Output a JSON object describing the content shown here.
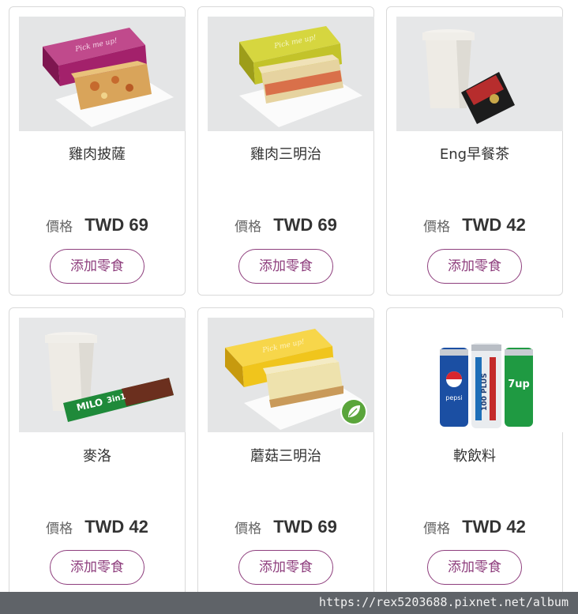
{
  "price_label": "價格",
  "button_label": "添加零食",
  "products": [
    {
      "name": "雞肉披薩",
      "price": "TWD 69"
    },
    {
      "name": "雞肉三明治",
      "price": "TWD 69"
    },
    {
      "name": "Eng早餐茶",
      "price": "TWD 42"
    },
    {
      "name": "麥洛",
      "price": "TWD 42"
    },
    {
      "name": "蘑菇三明治",
      "price": "TWD 69"
    },
    {
      "name": "軟飲料",
      "price": "TWD 42"
    }
  ],
  "image_text": {
    "box_slogan": "Pick me up!",
    "milo_brand": "MILO",
    "milo_variant": "3in1",
    "can_brands": [
      "pepsi",
      "100 PLUS",
      "7up"
    ]
  },
  "colors": {
    "accent": "#8e3e7d",
    "pizza_box": "#a3216b",
    "chicken_box": "#c3c32a",
    "mushroom_box": "#f0c51c",
    "vegetarian_badge": "#5aa53b"
  },
  "watermark": "https://rex5203688.pixnet.net/album"
}
